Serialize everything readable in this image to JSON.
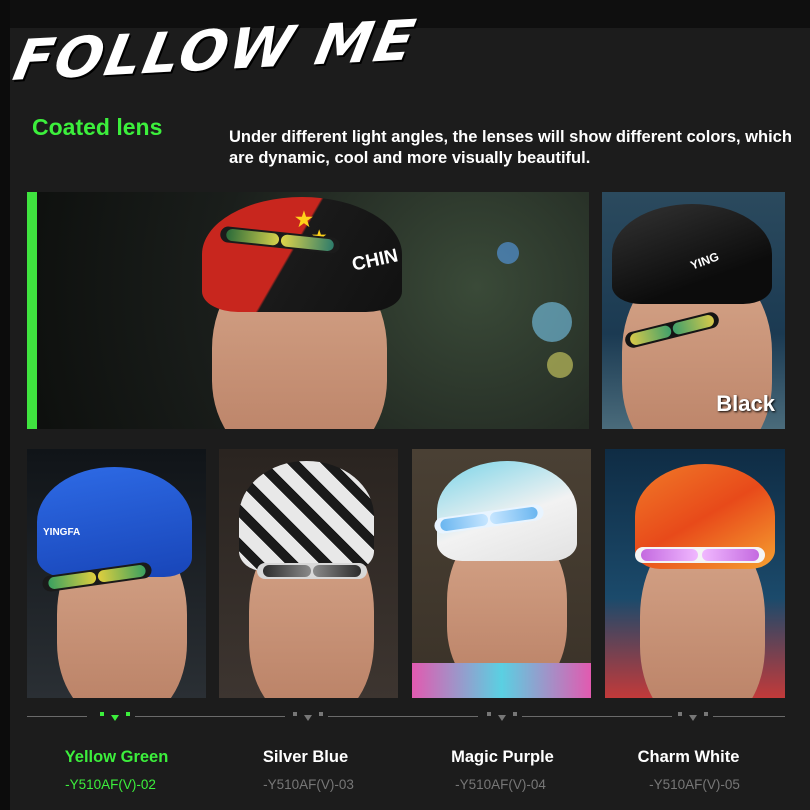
{
  "header": {
    "headline": "FOLLOW ME",
    "feature_title": "Coated lens",
    "description": "Under different light angles, the lenses will show different colors, which are dynamic, cool and more visually beautiful."
  },
  "hero": {
    "cap_print": "CHIN",
    "accent_color": "#3fe43f"
  },
  "side_photo": {
    "cap_print": "YING",
    "label": "Black"
  },
  "variants": [
    {
      "cap_print": "YINGFA",
      "name": "Yellow Green",
      "model": "-Y510AF(V)-02",
      "active": true
    },
    {
      "cap_print": "",
      "name": "Silver Blue",
      "model": "-Y510AF(V)-03",
      "active": false
    },
    {
      "cap_print": "",
      "name": "Magic Purple",
      "model": "-Y510AF(V)-04",
      "active": false
    },
    {
      "cap_print": "",
      "name": "Charm White",
      "model": "-Y510AF(V)-05",
      "active": false
    }
  ],
  "colors": {
    "accent_green": "#3cef3c",
    "background": "#1c1c1c",
    "muted_text": "#777777"
  }
}
